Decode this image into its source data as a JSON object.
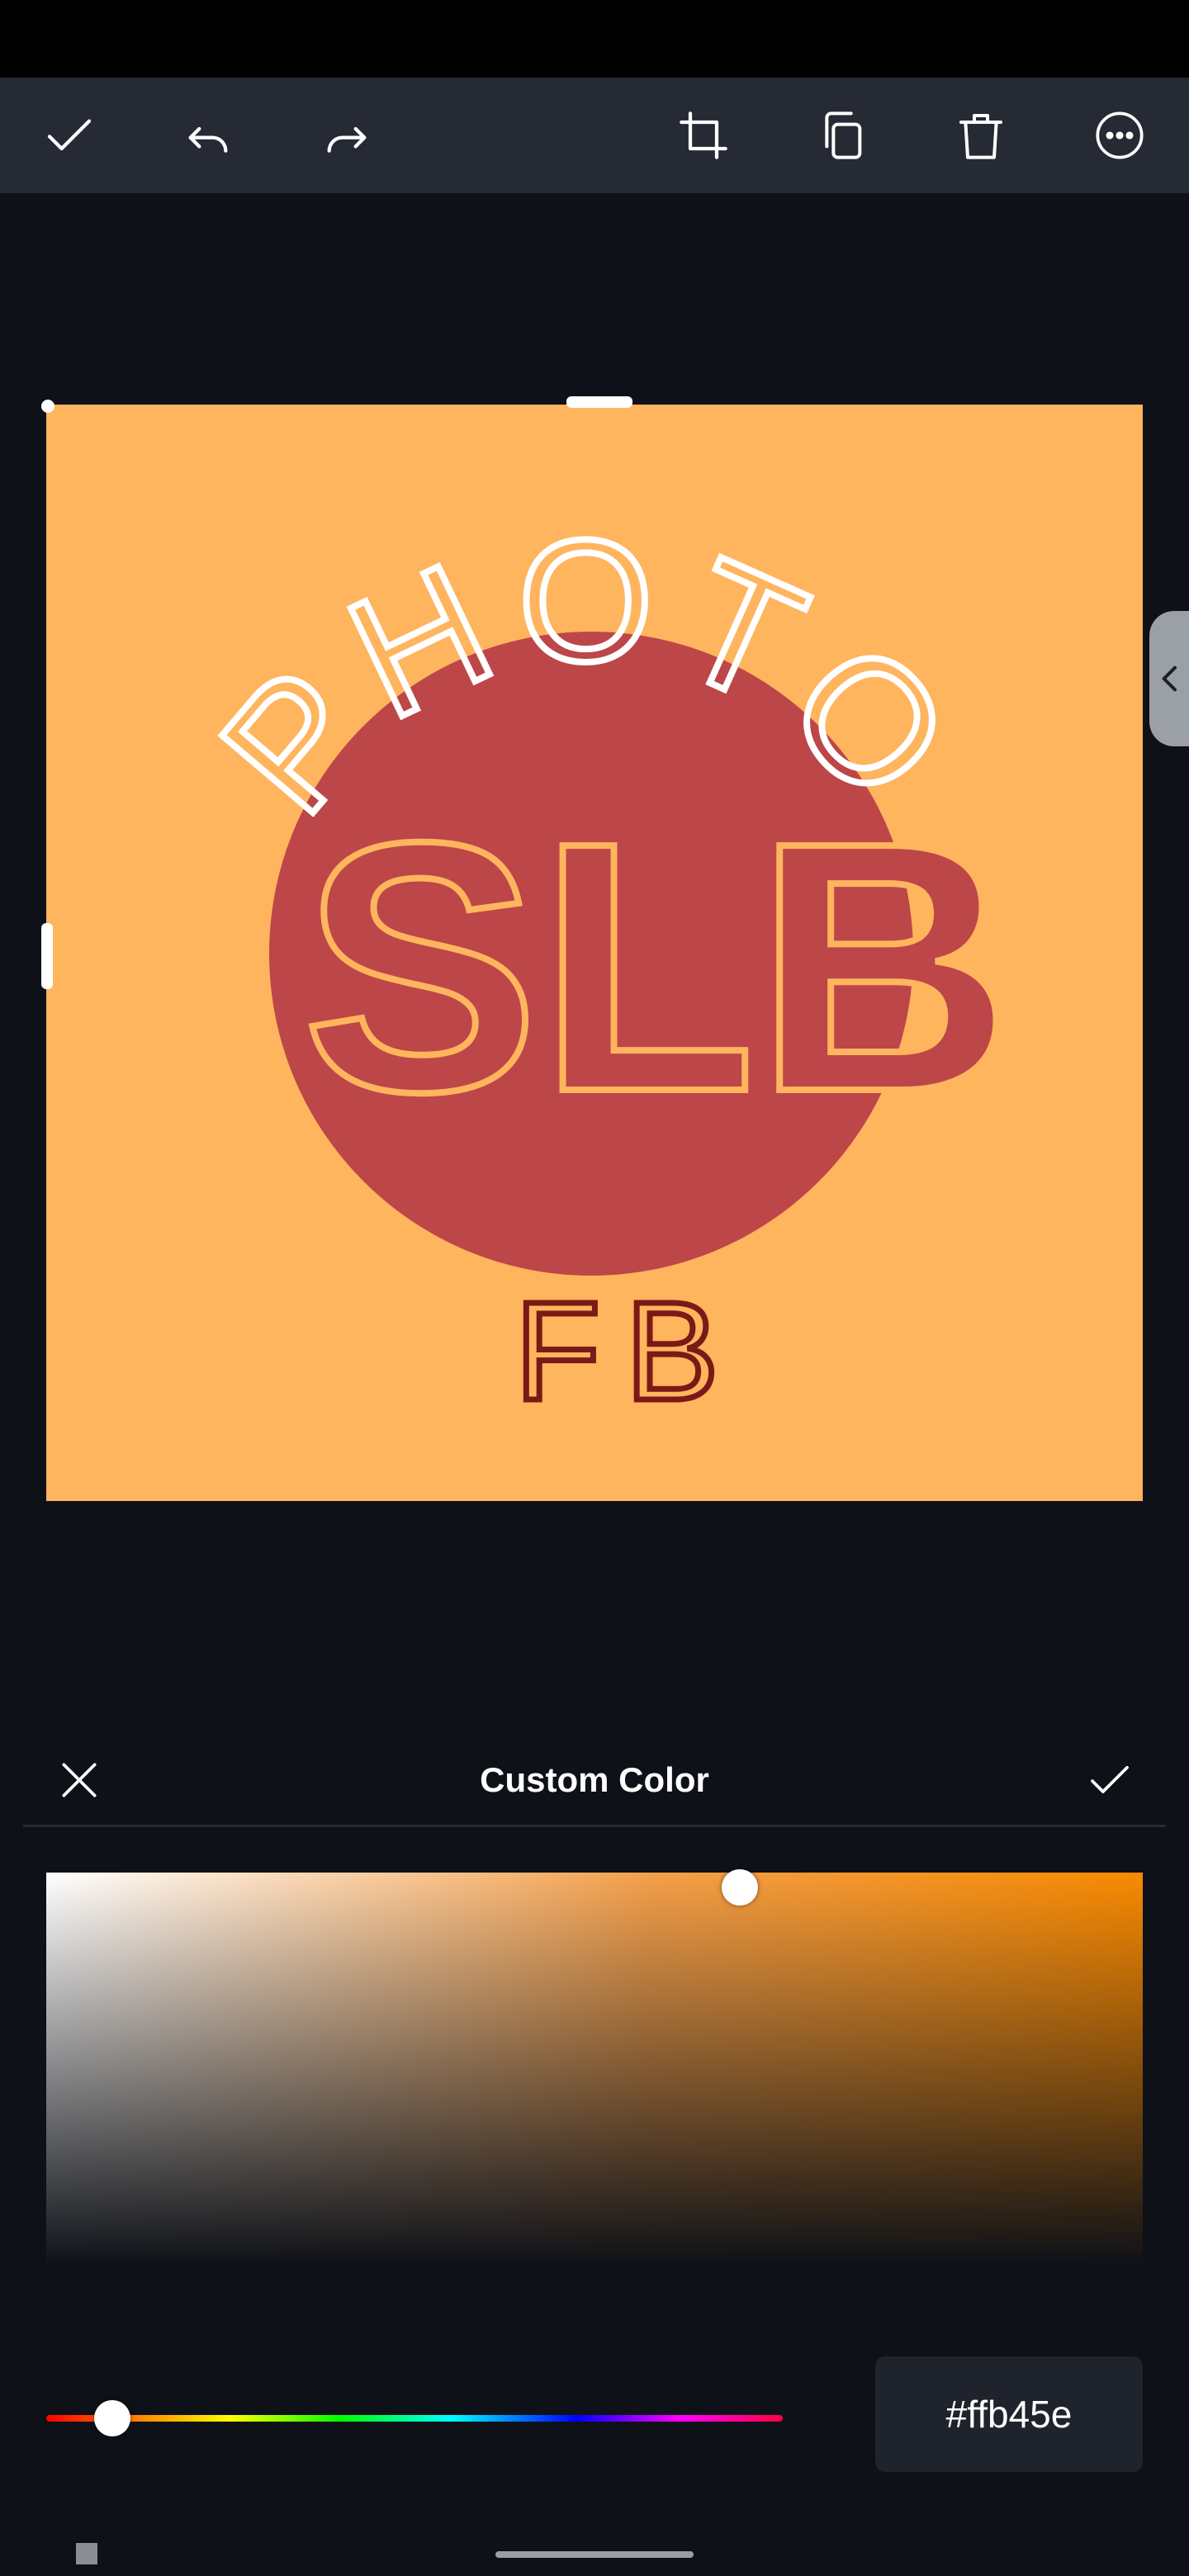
{
  "toolbar": {
    "buttons": [
      {
        "name": "confirm-button",
        "icon": "checkmark-icon"
      },
      {
        "name": "undo-button",
        "icon": "undo-icon"
      },
      {
        "name": "redo-button",
        "icon": "redo-icon"
      },
      {
        "name": "crop-button",
        "icon": "crop-icon"
      },
      {
        "name": "duplicate-button",
        "icon": "duplicate-icon"
      },
      {
        "name": "delete-button",
        "icon": "trash-icon"
      },
      {
        "name": "more-options-button",
        "icon": "more-icon"
      }
    ],
    "icon_color": "#ffffff",
    "background": "#252a35"
  },
  "design": {
    "background_color": "#ffb45e",
    "logo": {
      "arc_text": "PHOTO",
      "monogram": "SLB",
      "bottom_text": "FB",
      "circle_color": "#bd4648",
      "arc_text_color": "#ffffff",
      "bottom_text_color": "#7a1a16"
    }
  },
  "side_tab": {
    "icon": "chevron-left-icon"
  },
  "custom_color_panel": {
    "title": "Custom Color",
    "close_icon": "close-icon",
    "confirm_icon": "checkmark-icon",
    "hex_value": "#ffb45e",
    "hue_color": "#f98a00"
  },
  "system_nav": {
    "recent_icon": "square-icon",
    "home_indicator": "home-pill"
  }
}
